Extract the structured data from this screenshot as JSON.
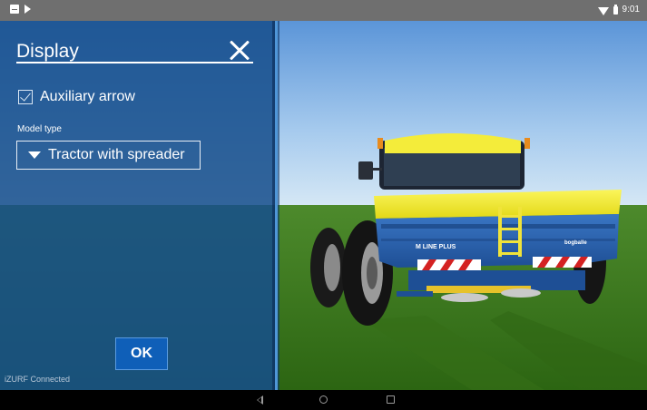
{
  "status_bar": {
    "time": "9:01",
    "icons": [
      "notification-icon",
      "play-store-icon",
      "wifi-icon",
      "battery-icon"
    ]
  },
  "display_panel": {
    "title": "Display",
    "close_icon": "close-icon",
    "auxiliary_arrow": {
      "label": "Auxiliary arrow",
      "checked": true
    },
    "model_type": {
      "label": "Model type",
      "selected": "Tractor with spreader"
    },
    "ok_label": "OK",
    "connection_status": "iZURF Connected"
  },
  "scene": {
    "spreader_brand_left": "M LINE PLUS",
    "spreader_brand_right": "bogballe",
    "colors": {
      "sky_top": "#5b95d8",
      "sky_bottom": "#cfe3f4",
      "grass": "#3d7a1e",
      "hopper_blue": "#2a5ea8",
      "hopper_yellow": "#f2ea2a"
    }
  },
  "nav_bar": {
    "buttons": [
      "back-icon",
      "home-icon",
      "recents-icon"
    ]
  },
  "colors": {
    "panel_blue": "#164e8c",
    "button_blue": "#0f5fb8",
    "status_bar": "#6f6f6f"
  }
}
